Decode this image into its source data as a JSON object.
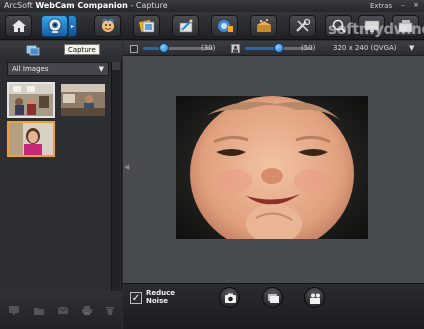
{
  "window": {
    "brand": "ArcSoft",
    "app_name": "WebCam Companion",
    "separator": "- Capture",
    "extras": "Extras",
    "min_symbol": "–",
    "close_symbol": "×"
  },
  "toolbar": {
    "buttons": [
      {
        "icon": "home-icon"
      },
      {
        "icon": "capture-webcam-icon",
        "active": true
      },
      {
        "icon": "face-effects-icon"
      },
      {
        "icon": "frames-icon"
      },
      {
        "icon": "edit-wand-icon"
      },
      {
        "icon": "monitor-surveillance-icon"
      },
      {
        "icon": "magic-box-icon"
      },
      {
        "icon": "tools-settings-icon"
      },
      {
        "icon": "zoom-icon"
      },
      {
        "icon": "display-icon"
      },
      {
        "icon": "share-icon"
      }
    ],
    "tooltip": "Capture"
  },
  "watermark": "softmydw.net",
  "left_panel": {
    "filter_label": "All Images",
    "dropdown_icon": "▼"
  },
  "preview_bar": {
    "brightness_value": "(30)",
    "contrast_value": "(50)",
    "resolution": "320 x 240 (QVGA)",
    "dropdown_icon": "▼",
    "brightness_level": 0.3,
    "contrast_level": 0.5
  },
  "capture_bar": {
    "reduce_noise_line1": "Reduce",
    "reduce_noise_line2": "Noise",
    "reduce_checked": true,
    "check_mark": "✓"
  },
  "colors": {
    "accent": "#1e6fbf",
    "active_button": "#3aa6e8",
    "background": "#2a2c30"
  }
}
